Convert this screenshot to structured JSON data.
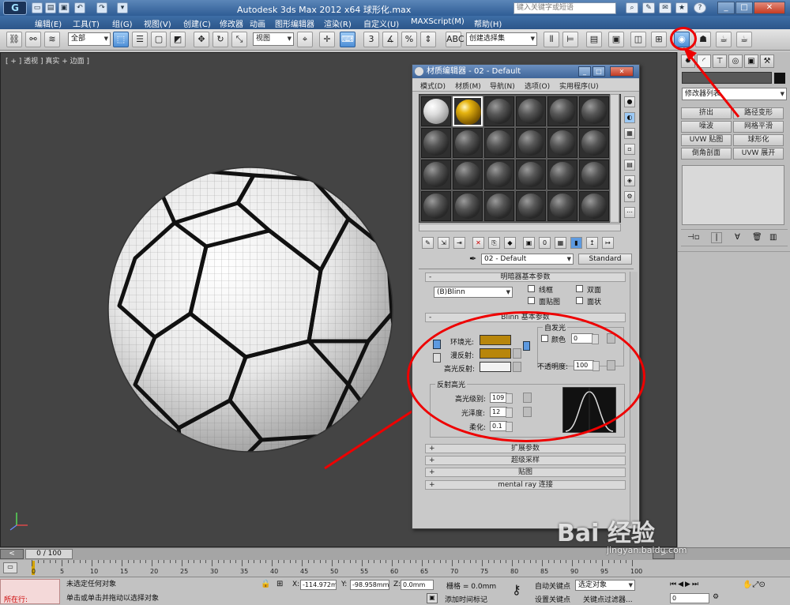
{
  "title_bar": {
    "logo": "G",
    "title": "Autodesk 3ds Max  2012 x64     球形化.max",
    "search_placeholder": "键入关键字或短语",
    "help": "?"
  },
  "menu": [
    "编辑(E)",
    "工具(T)",
    "组(G)",
    "视图(V)",
    "创建(C)",
    "修改器",
    "动画",
    "图形编辑器",
    "渲染(R)",
    "自定义(U)",
    "MAXScript(M)",
    "帮助(H)"
  ],
  "toolbar": {
    "filter": "全部",
    "coord": "视图",
    "selection_set": "创建选择集"
  },
  "viewport": {
    "label": "[ + ] 透视 ] 真实 + 边面 ]"
  },
  "material_editor": {
    "title": "材质编辑器 - 02 - Default",
    "menu": [
      "模式(D)",
      "材质(M)",
      "导航(N)",
      "选项(O)",
      "实用程序(U)"
    ],
    "material_name": "02 - Default",
    "material_type": "Standard",
    "rollouts": {
      "shader_basic": "明暗器基本参数",
      "blinn_basic": "Blinn 基本参数",
      "extended": "扩展参数",
      "supersampling": "超级采样",
      "maps": "贴图",
      "mental_ray": "mental ray 连接"
    },
    "shader": {
      "type": "(B)Blinn",
      "wire": "线框",
      "two_sided": "双面",
      "face_map": "面贴图",
      "faceted": "面状"
    },
    "blinn": {
      "ambient": "环境光:",
      "diffuse": "漫反射:",
      "specular": "高光反射:",
      "self_illum_title": "自发光",
      "color": "颜色",
      "self_illum_value": "0",
      "opacity_label": "不透明度:",
      "opacity_value": "100",
      "spec_title": "反射高光",
      "spec_level_label": "高光级别:",
      "spec_level": "109",
      "gloss_label": "光泽度:",
      "gloss": "12",
      "soften_label": "柔化:",
      "soften": "0.1",
      "ambient_color": "#b8860b",
      "diffuse_color": "#b8860b",
      "specular_color": "#f2f2f2"
    }
  },
  "command_panel": {
    "modifier_list": "修改器列表",
    "buttons": [
      "挤出",
      "路径变形",
      "噪波",
      "网格平滑",
      "UVW 贴图",
      "球形化",
      "倒角剖面",
      "UVW 展开"
    ]
  },
  "timeline": {
    "frame": "0 / 100",
    "ticks": [
      "0",
      "5",
      "10",
      "15",
      "20",
      "25",
      "30",
      "35",
      "40",
      "45",
      "50",
      "55",
      "60",
      "65",
      "70",
      "75",
      "80",
      "85",
      "90",
      "95",
      "100"
    ]
  },
  "status": {
    "working": "所在行:",
    "no_selection": "未选定任何对象",
    "prompt": "单击或单击并拖动以选择对象",
    "x_label": "X:",
    "x": "-114.972m",
    "y_label": "Y:",
    "y": "-98.958mm",
    "z_label": "Z:",
    "z": "0.0mm",
    "grid": "栅格 = 0.0mm",
    "add_time_tag": "添加时间标记",
    "auto_key": "自动关键点",
    "set_key": "设置关键点",
    "selected": "选定对象",
    "key_filters": "关键点过滤器...",
    "frame_field": "0"
  },
  "watermark": {
    "brand": "Bai 经验",
    "url": "jingyan.baidu.com"
  }
}
